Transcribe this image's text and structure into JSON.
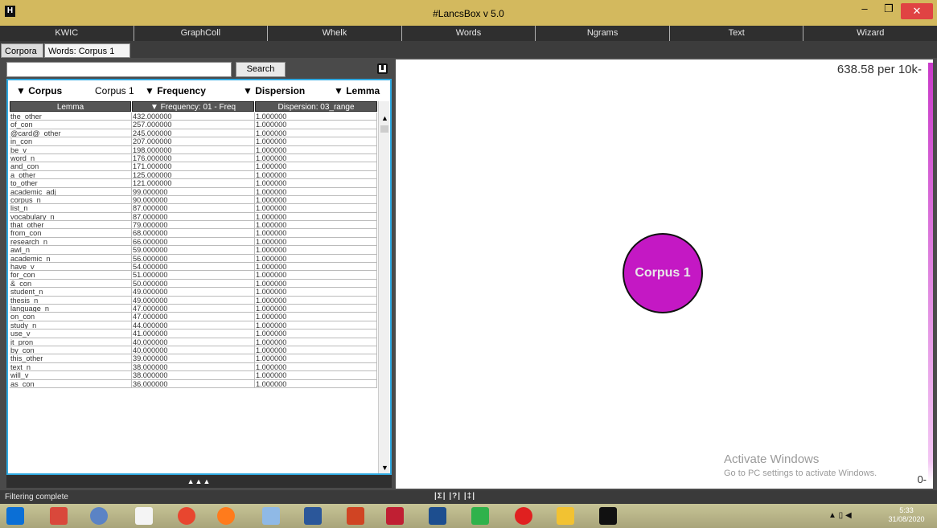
{
  "window": {
    "title": "#LancsBox v 5.0",
    "minimize": "–",
    "maximize": "❐",
    "close": "✕"
  },
  "tool_tabs": [
    "KWIC",
    "GraphColl",
    "Whelk",
    "Words",
    "Ngrams",
    "Text",
    "Wizard"
  ],
  "sub_tabs": {
    "corpora": "Corpora",
    "words": "Words: Corpus 1",
    "close": "✕"
  },
  "search": {
    "button": "Search",
    "value": ""
  },
  "filters": {
    "corpus_label": "▼ Corpus",
    "corpus_value": "Corpus 1",
    "frequency_label": "▼ Frequency",
    "dispersion_label": "▼ Dispersion",
    "lemma_label": "▼ Lemma"
  },
  "table": {
    "headers": [
      "Lemma",
      "▼ Frequency: 01 - Freq",
      "Dispersion: 03_range"
    ],
    "rows": [
      [
        "the_other",
        "432.000000",
        "1.000000"
      ],
      [
        "of_con",
        "257.000000",
        "1.000000"
      ],
      [
        "@card@_other",
        "245.000000",
        "1.000000"
      ],
      [
        "in_con",
        "207.000000",
        "1.000000"
      ],
      [
        "be_v",
        "198.000000",
        "1.000000"
      ],
      [
        "word_n",
        "176.000000",
        "1.000000"
      ],
      [
        "and_con",
        "171.000000",
        "1.000000"
      ],
      [
        "a_other",
        "125.000000",
        "1.000000"
      ],
      [
        "to_other",
        "121.000000",
        "1.000000"
      ],
      [
        "academic_adj",
        "99.000000",
        "1.000000"
      ],
      [
        "corpus_n",
        "90.000000",
        "1.000000"
      ],
      [
        "list_n",
        "87.000000",
        "1.000000"
      ],
      [
        "vocabulary_n",
        "87.000000",
        "1.000000"
      ],
      [
        "that_other",
        "79.000000",
        "1.000000"
      ],
      [
        "from_con",
        "68.000000",
        "1.000000"
      ],
      [
        "research_n",
        "66.000000",
        "1.000000"
      ],
      [
        "awl_n",
        "59.000000",
        "1.000000"
      ],
      [
        "academic_n",
        "56.000000",
        "1.000000"
      ],
      [
        "have_v",
        "54.000000",
        "1.000000"
      ],
      [
        "for_con",
        "51.000000",
        "1.000000"
      ],
      [
        "&_con",
        "50.000000",
        "1.000000"
      ],
      [
        "student_n",
        "49.000000",
        "1.000000"
      ],
      [
        "thesis_n",
        "49.000000",
        "1.000000"
      ],
      [
        "language_n",
        "47.000000",
        "1.000000"
      ],
      [
        "on_con",
        "47.000000",
        "1.000000"
      ],
      [
        "study_n",
        "44.000000",
        "1.000000"
      ],
      [
        "use_v",
        "41.000000",
        "1.000000"
      ],
      [
        "it_pron",
        "40.000000",
        "1.000000"
      ],
      [
        "by_con",
        "40.000000",
        "1.000000"
      ],
      [
        "this_other",
        "39.000000",
        "1.000000"
      ],
      [
        "text_n",
        "38.000000",
        "1.000000"
      ],
      [
        "will_v",
        "38.000000",
        "1.000000"
      ],
      [
        "as_con",
        "36.000000",
        "1.000000"
      ]
    ]
  },
  "collapse": "▲▲▲",
  "viz": {
    "max_label": "638.58 per 10k-",
    "min_label": "0-",
    "node_label": "Corpus 1"
  },
  "watermark": {
    "line1": "Activate Windows",
    "line2": "Go to PC settings to activate Windows."
  },
  "status": {
    "text": "Filtering complete",
    "stats": "|Σ| |?| |‡|"
  },
  "clock": {
    "time": "5:33",
    "date": "31/08/2020"
  },
  "colors": {
    "title_bar": "#d3b95e",
    "node": "#c418c4",
    "table_border": "#2ea8e0"
  }
}
